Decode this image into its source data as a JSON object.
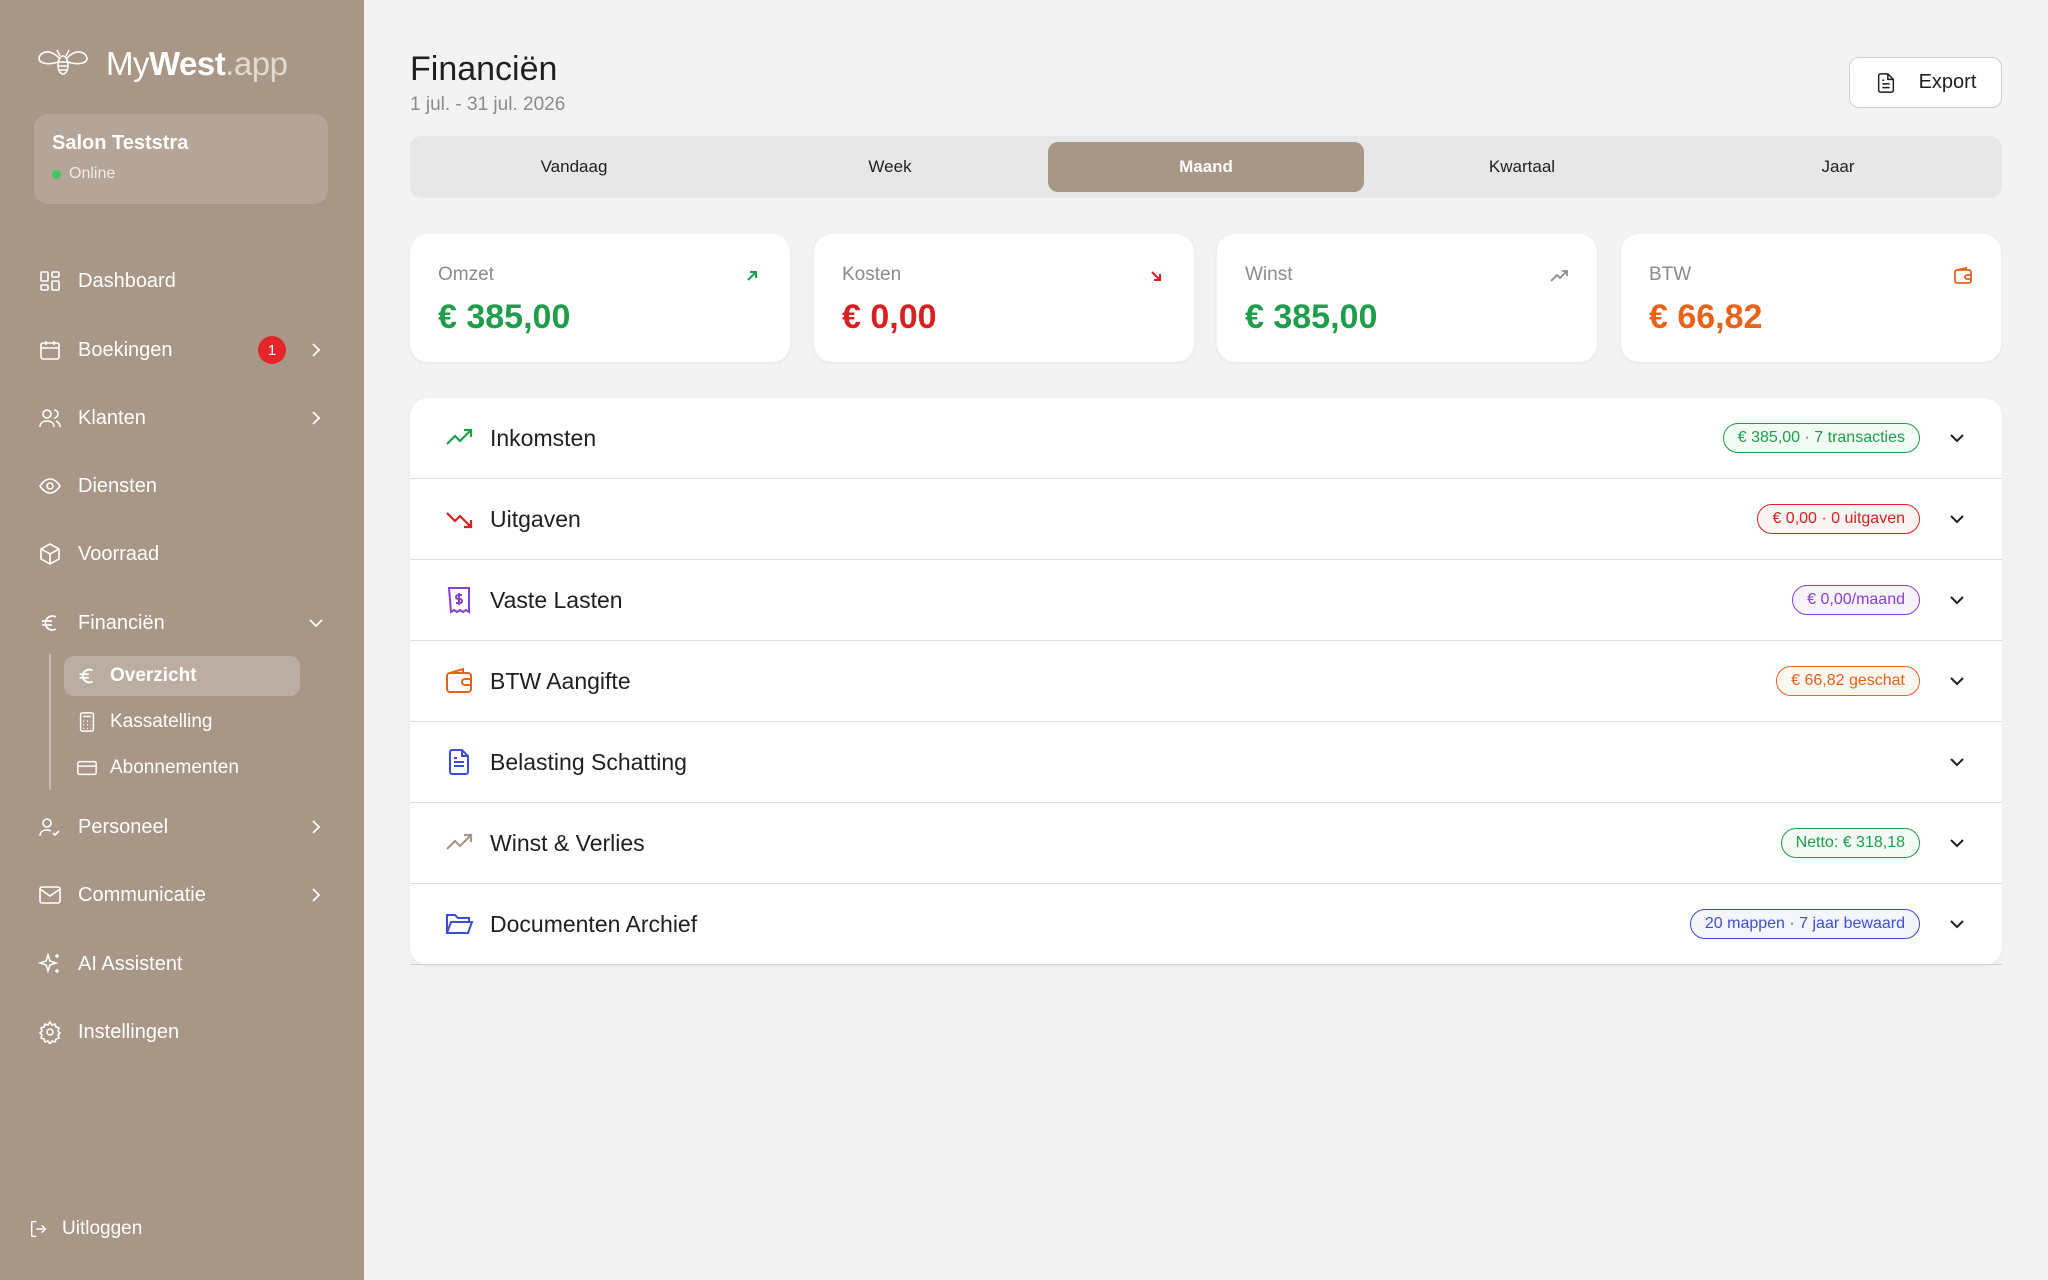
{
  "brand": {
    "prefix": "My",
    "bold": "West",
    "suffix": ".app"
  },
  "salon": {
    "name": "Salon Teststra",
    "status": "Online"
  },
  "nav": {
    "dashboard": "Dashboard",
    "boekingen": "Boekingen",
    "boekingen_badge": "1",
    "klanten": "Klanten",
    "diensten": "Diensten",
    "voorraad": "Voorraad",
    "financien": "Financiën",
    "overzicht": "Overzicht",
    "kassatelling": "Kassatelling",
    "abonnementen": "Abonnementen",
    "personeel": "Personeel",
    "communicatie": "Communicatie",
    "ai": "AI Assistent",
    "instellingen": "Instellingen",
    "logout": "Uitloggen"
  },
  "header": {
    "title": "Financiën",
    "subtitle": "1 jul. - 31 jul. 2026",
    "export_label": "Export"
  },
  "tabs": [
    "Vandaag",
    "Week",
    "Maand",
    "Kwartaal",
    "Jaar"
  ],
  "active_tab": "Maand",
  "stats": [
    {
      "label": "Omzet",
      "value": "€ 385,00",
      "color": "#1e9e4a",
      "icon": "arrow-up-right-icon"
    },
    {
      "label": "Kosten",
      "value": "€ 0,00",
      "color": "#d92020",
      "icon": "arrow-down-right-icon"
    },
    {
      "label": "Winst",
      "value": "€ 385,00",
      "color": "#1e9e4a",
      "icon": "trending-up-icon"
    },
    {
      "label": "BTW",
      "value": "€ 66,82",
      "color": "#e8621a",
      "icon": "wallet-icon"
    }
  ],
  "sections": [
    {
      "title": "Inkomsten",
      "pill": "€ 385,00 · 7 transacties",
      "color": "#1e9e4a"
    },
    {
      "title": "Uitgaven",
      "pill": "€ 0,00 · 0 uitgaven",
      "color": "#d92020"
    },
    {
      "title": "Vaste Lasten",
      "pill": "€ 0,00/maand",
      "color": "#8a3ddb"
    },
    {
      "title": "BTW Aangifte",
      "pill": "€ 66,82 geschat",
      "color": "#e8621a"
    },
    {
      "title": "Belasting Schatting",
      "pill": "",
      "color": "#3b4fd6"
    },
    {
      "title": "Winst & Verlies",
      "pill": "Netto: € 318,18",
      "color": "#1e9e4a"
    },
    {
      "title": "Documenten Archief",
      "pill": "20 mappen · 7 jaar bewaard",
      "color": "#3b4fd6"
    }
  ]
}
